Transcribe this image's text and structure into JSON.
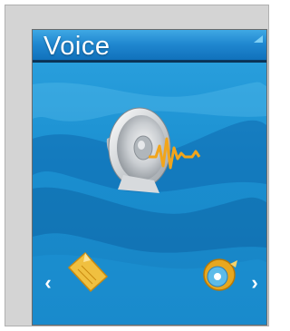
{
  "header": {
    "title": "Voice"
  },
  "menu": {
    "current_item": {
      "icon": "speaker-sound-wave-icon",
      "label": "Voice"
    },
    "previous_item": {
      "icon": "document-icon"
    },
    "next_item": {
      "icon": "disc-icon"
    }
  },
  "nav": {
    "left_arrow": "‹",
    "right_arrow": "›"
  },
  "colors": {
    "screen_blue": "#1a8fd0",
    "title_text": "#ffffff",
    "frame": "#d4d4d4",
    "wave": "#f2a51a"
  }
}
